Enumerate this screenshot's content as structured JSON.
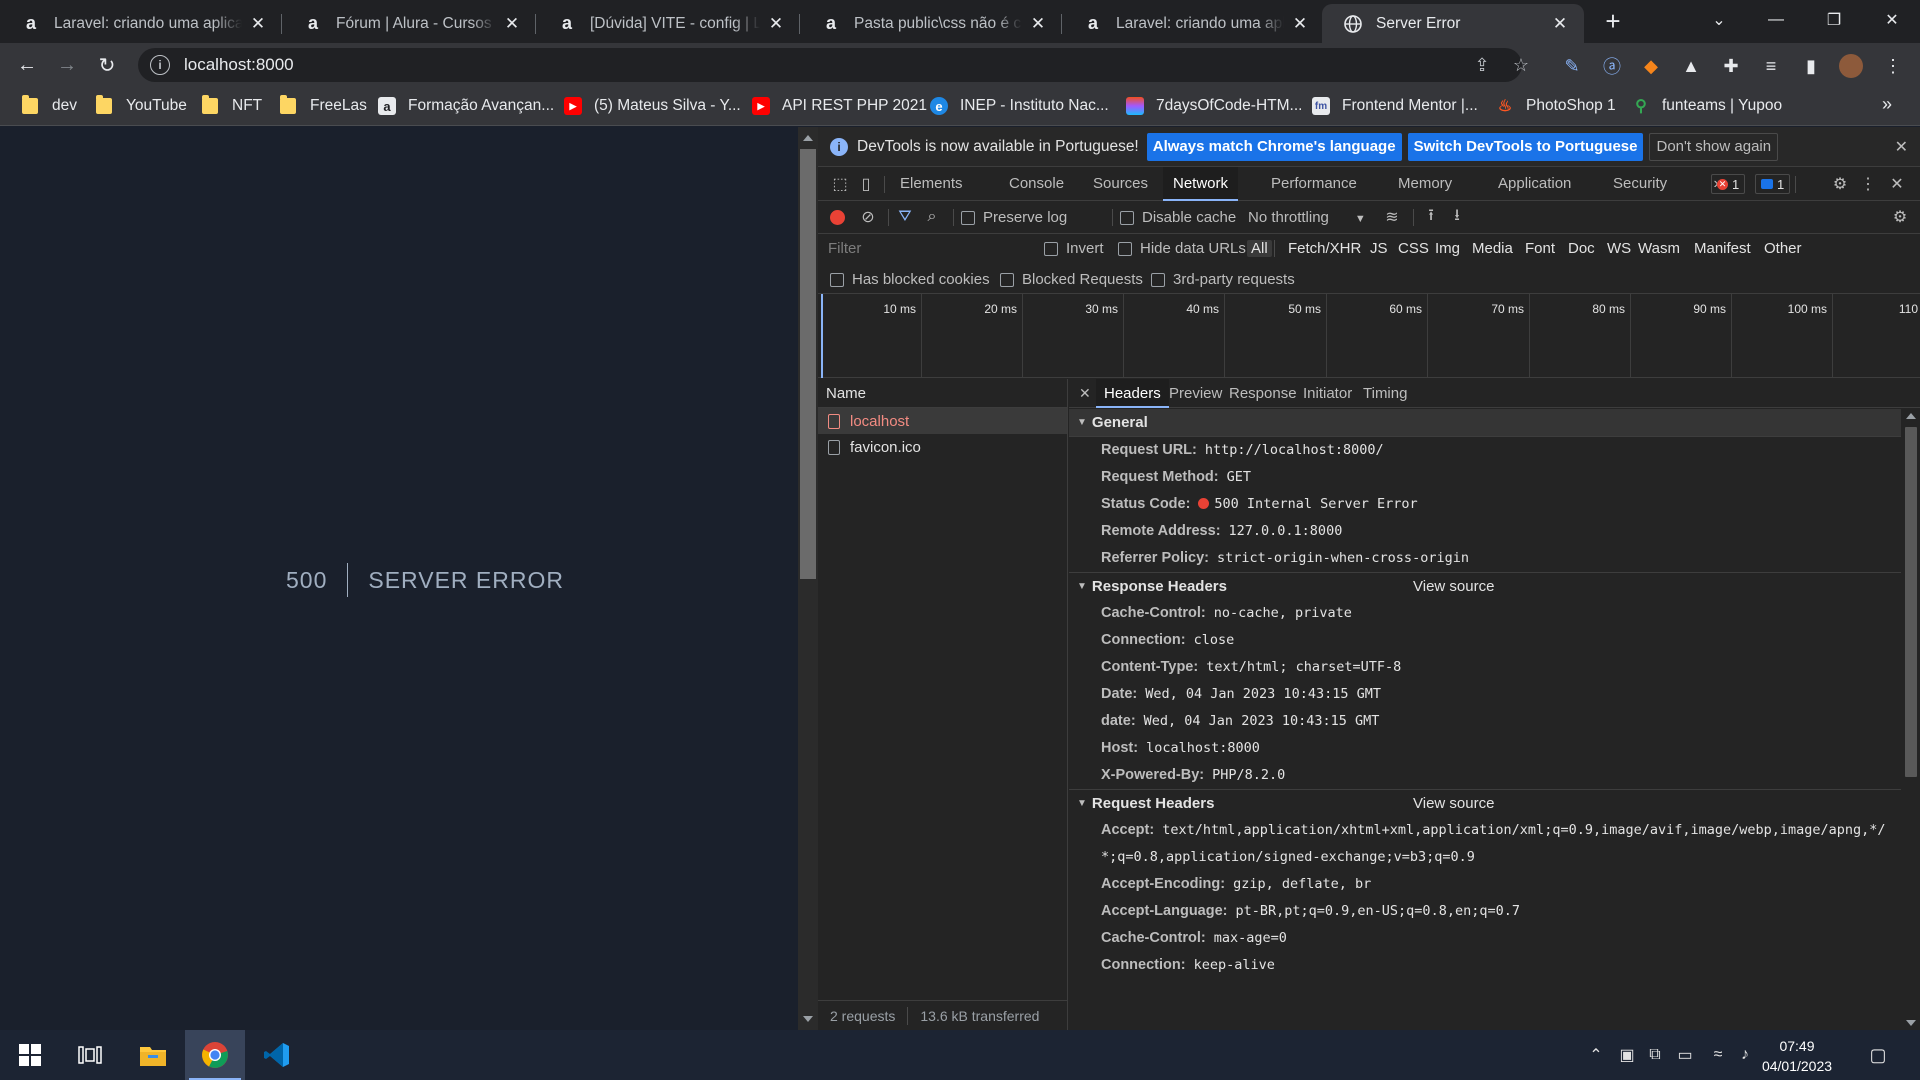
{
  "tabs": [
    {
      "title": "Laravel: criando uma aplicação",
      "icon": "alura-icon"
    },
    {
      "title": "Fórum | Alura - Cursos online",
      "icon": "alura-icon"
    },
    {
      "title": "[Dúvida] VITE - config | Laravel",
      "icon": "alura-icon"
    },
    {
      "title": "Pasta public\\css não é criada",
      "icon": "alura-icon"
    },
    {
      "title": "Laravel: criando uma aplicação",
      "icon": "alura-icon"
    },
    {
      "title": "Server Error",
      "icon": "globe-icon"
    }
  ],
  "address_bar": {
    "url": "localhost:8000"
  },
  "bookmarks": [
    {
      "label": "dev",
      "icon": "folder"
    },
    {
      "label": "YouTube",
      "icon": "folder"
    },
    {
      "label": "NFT",
      "icon": "folder"
    },
    {
      "label": "FreeLas",
      "icon": "folder"
    },
    {
      "label": "Formação Avançan...",
      "icon": "alura"
    },
    {
      "label": "(5) Mateus Silva - Y...",
      "icon": "youtube"
    },
    {
      "label": "API REST PHP 2021",
      "icon": "youtube"
    },
    {
      "label": "INEP - Instituto Nac...",
      "icon": "edge"
    },
    {
      "label": "7daysOfCode-HTM...",
      "icon": "figma"
    },
    {
      "label": "Frontend Mentor |...",
      "icon": "fm"
    },
    {
      "label": "PhotoShop 1",
      "icon": "flame"
    },
    {
      "label": "funteams | Yupoo",
      "icon": "pin"
    }
  ],
  "page": {
    "error_code": "500",
    "error_message": "Server Error"
  },
  "devtools": {
    "infobar": {
      "text": "DevTools is now available in Portuguese!",
      "btn_match": "Always match Chrome's language",
      "btn_switch": "Switch DevTools to Portuguese",
      "btn_dismiss": "Don't show again"
    },
    "panels": [
      "Elements",
      "Console",
      "Sources",
      "Network",
      "Performance",
      "Memory",
      "Application",
      "Security"
    ],
    "active_panel": "Network",
    "error_count": "1",
    "message_count": "1",
    "toolbar": {
      "preserve_log": "Preserve log",
      "disable_cache": "Disable cache",
      "throttling": "No throttling"
    },
    "filter": {
      "placeholder": "Filter",
      "invert": "Invert",
      "hide_data_urls": "Hide data URLs",
      "types": [
        "All",
        "Fetch/XHR",
        "JS",
        "CSS",
        "Img",
        "Media",
        "Font",
        "Doc",
        "WS",
        "Wasm",
        "Manifest",
        "Other"
      ],
      "has_blocked_cookies": "Has blocked cookies",
      "blocked_requests": "Blocked Requests",
      "third_party": "3rd-party requests"
    },
    "timeline_labels": [
      "10 ms",
      "20 ms",
      "30 ms",
      "40 ms",
      "50 ms",
      "60 ms",
      "70 ms",
      "80 ms",
      "90 ms",
      "100 ms",
      "110"
    ],
    "requests": {
      "header": "Name",
      "items": [
        {
          "name": "localhost",
          "status": "error"
        },
        {
          "name": "favicon.ico",
          "status": "ok"
        }
      ],
      "summary_count": "2 requests",
      "summary_transferred": "13.6 kB transferred"
    },
    "detail_tabs": [
      "Headers",
      "Preview",
      "Response",
      "Initiator",
      "Timing"
    ],
    "active_detail_tab": "Headers",
    "general": {
      "title": "General",
      "rows": [
        {
          "key": "Request URL:",
          "value": "http://localhost:8000/"
        },
        {
          "key": "Request Method:",
          "value": "GET"
        },
        {
          "key": "Status Code:",
          "value": "500 Internal Server Error"
        },
        {
          "key": "Remote Address:",
          "value": "127.0.0.1:8000"
        },
        {
          "key": "Referrer Policy:",
          "value": "strict-origin-when-cross-origin"
        }
      ]
    },
    "response_headers": {
      "title": "Response Headers",
      "view_source": "View source",
      "rows": [
        {
          "key": "Cache-Control:",
          "value": "no-cache, private"
        },
        {
          "key": "Connection:",
          "value": "close"
        },
        {
          "key": "Content-Type:",
          "value": "text/html; charset=UTF-8"
        },
        {
          "key": "Date:",
          "value": "Wed, 04 Jan 2023 10:43:15 GMT"
        },
        {
          "key": "date:",
          "value": "Wed, 04 Jan 2023 10:43:15 GMT"
        },
        {
          "key": "Host:",
          "value": "localhost:8000"
        },
        {
          "key": "X-Powered-By:",
          "value": "PHP/8.2.0"
        }
      ]
    },
    "request_headers": {
      "title": "Request Headers",
      "view_source": "View source",
      "accept_key": "Accept:",
      "accept_line1": "text/html,application/xhtml+xml,application/xml;q=0.9,image/avif,image/webp,image/apng,*/",
      "accept_line2": "*;q=0.8,application/signed-exchange;v=b3;q=0.9",
      "rows": [
        {
          "key": "Accept-Encoding:",
          "value": "gzip, deflate, br"
        },
        {
          "key": "Accept-Language:",
          "value": "pt-BR,pt;q=0.9,en-US;q=0.8,en;q=0.7"
        },
        {
          "key": "Cache-Control:",
          "value": "max-age=0"
        },
        {
          "key": "Connection:",
          "value": "keep-alive"
        }
      ]
    }
  },
  "taskbar": {
    "time": "07:49",
    "date": "04/01/2023"
  },
  "colors": {
    "error_red": "#e94235",
    "accent_blue": "#1a73e8",
    "page_bg": "#1a202c"
  }
}
